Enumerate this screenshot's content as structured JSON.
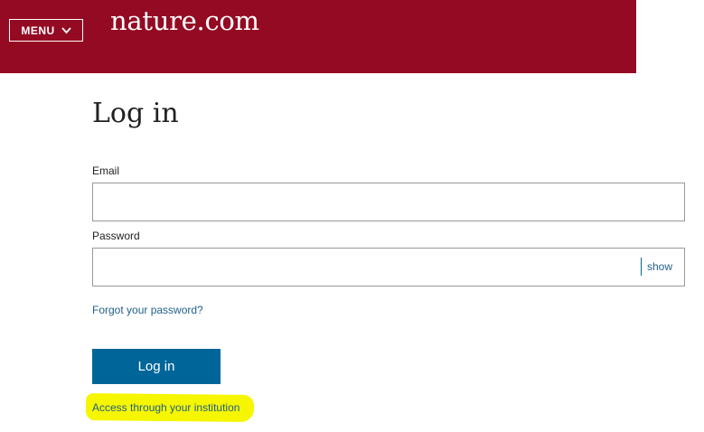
{
  "header": {
    "menu_label": "MENU",
    "menu_icon": "chevron-down-icon",
    "logo_text": "nature.com",
    "background_color": "#940a23"
  },
  "login": {
    "title": "Log in",
    "email_label": "Email",
    "email_value": "",
    "password_label": "Password",
    "password_value": "",
    "show_label": "show",
    "forgot_label": "Forgot your password?",
    "submit_label": "Log in",
    "submit_color": "#006699",
    "institution_label": "Access through your institution",
    "highlight_color": "#f6f600"
  }
}
